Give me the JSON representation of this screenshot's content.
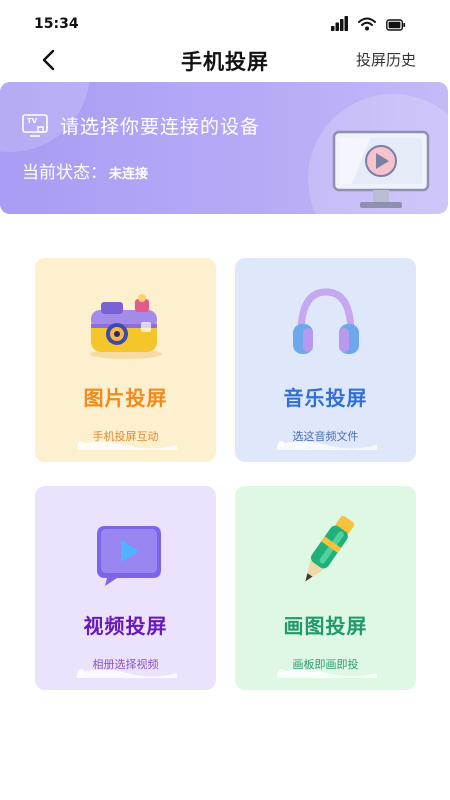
{
  "status_bar": {
    "time": "15:34"
  },
  "nav": {
    "title": "手机投屏",
    "history": "投屏历史"
  },
  "banner": {
    "tv_badge": "TV",
    "heading": "请选择你要连接的设备",
    "status_label": "当前状态：",
    "status_value": "未连接"
  },
  "cards": [
    {
      "title": "图片投屏",
      "subtitle": "手机投屏互动"
    },
    {
      "title": "音乐投屏",
      "subtitle": "选这音频文件"
    },
    {
      "title": "视频投屏",
      "subtitle": "相册选择视频"
    },
    {
      "title": "画图投屏",
      "subtitle": "画板即画即投"
    }
  ],
  "colors": {
    "banner": "#a89cf4",
    "photo_bg": "#fdf0cf",
    "music_bg": "#dfe7fb",
    "video_bg": "#ebe3fd",
    "draw_bg": "#def8e3"
  }
}
